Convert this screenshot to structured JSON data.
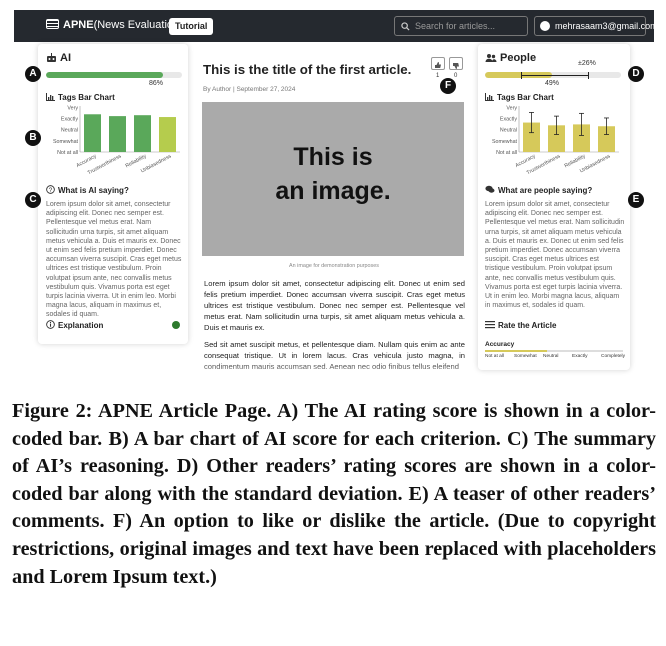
{
  "nav": {
    "brand": "APNE",
    "brand_sub": "(News Evaluation)",
    "tutorial": "Tutorial",
    "search_placeholder": "Search for articles...",
    "account": "mehrasaam3@gmail.com"
  },
  "ai": {
    "title": "AI",
    "score_label": "86%",
    "score": 0.86,
    "tags_title": "Tags Bar Chart",
    "summary_title": "What is AI saying?",
    "summary": "Lorem ipsum dolor sit amet, consectetur adipiscing elit. Donec nec semper est. Pellentesque vel metus erat. Nam sollicitudin urna turpis, sit amet aliquam metus vehicula a. Duis et mauris ex. Donec ut enim sed felis pretium imperdiet. Donec accumsan viverra suscipit. Cras eget metus ultrices est tristique vestibulum. Proin volutpat ipsum ante, nec convallis metus vestibulum quis. Vivamus porta est eget turpis lacinia viverra. Ut in enim leo. Morbi magna lacus, aliquam in maximus et, sodales id quam.",
    "explanation": "Explanation"
  },
  "article": {
    "title": "This is the title of the first article.",
    "byline": "By Author | September 27, 2024",
    "image_text_1": "This is",
    "image_text_2": "an image.",
    "image_caption": "An image for demonstration purposes",
    "para1": "Lorem ipsum dolor sit amet, consectetur adipiscing elit. Donec ut enim sed felis pretium imperdiet. Donec accumsan viverra suscipit. Cras eget metus ultrices est tristique vestibulum. Donec nec semper est. Pellentesque vel metus erat. Nam sollicitudin urna turpis, sit amet aliquam metus vehicula a. Duis et mauris ex.",
    "para2": "Sed sit amet suscipit metus, et pellentesque diam. Nullam quis enim ac ante consequat tristique. Ut in lorem lacus. Cras vehicula justo magna, in condimentum mauris accumsan sed. Aenean nec odio finibus tellus eleifend",
    "likes": "1",
    "dislikes": "0"
  },
  "people": {
    "title": "People",
    "std_label": "±26%",
    "score_label": "49%",
    "score": 0.49,
    "tags_title": "Tags Bar Chart",
    "comments_title": "What are people saying?",
    "comments": "Lorem ipsum dolor sit amet, consectetur adipiscing elit. Donec nec semper est. Pellentesque vel metus erat. Nam sollicitudin urna turpis, sit amet aliquam metus vehicula a. Duis et mauris ex. Donec ut enim sed felis pretium imperdiet. Donec accumsan viverra suscipit. Cras eget metus ultrices est tristique vestibulum. Proin volutpat ipsum ante, nec convallis metus vestibulum quis. Vivamus porta est eget turpis lacinia viverra. Ut in enim leo. Morbi magna lacus, aliquam in maximus et, sodales id quam.",
    "rate_title": "Rate the Article",
    "accuracy": "Accuracy",
    "scale": [
      "Not at all",
      "Somewhat",
      "Neutral",
      "Exactly",
      "Completely"
    ]
  },
  "markers": {
    "a": "A",
    "b": "B",
    "c": "C",
    "d": "D",
    "e": "E",
    "f": "F"
  },
  "caption": "Figure 2: APNE Article Page. A) The AI rating score is shown in a color-coded bar. B) A bar chart of AI score for each criterion. C) The summary of AI’s reasoning. D) Other readers’ rating scores are shown in a color-coded bar along with the standard deviation. E) A teaser of other readers’ comments. F) An option to like or dislike the article. (Due to copyright restrictions, original images and text have been replaced with placeholders and Lorem Ipsum text.)",
  "colors": {
    "ai_fill": "#5aa85a",
    "people_fill": "#d6c95a",
    "nav": "#25292f"
  },
  "chart_data": [
    {
      "type": "bar",
      "categories": [
        "Accuracy",
        "Trustworthiness",
        "Reliability",
        "Unbiasedness"
      ],
      "values": [
        4.1,
        3.9,
        4.0,
        3.8
      ],
      "yticks": [
        "Not at all",
        "Somewhat",
        "Neutral",
        "Exactly",
        "Very"
      ],
      "ylim": [
        0,
        5
      ],
      "colors": [
        "#5aa85a",
        "#5aa85a",
        "#5aa85a",
        "#b5cc4d"
      ]
    },
    {
      "type": "bar",
      "categories": [
        "Accuracy",
        "Trustworthiness",
        "Reliability",
        "Unbiasedness"
      ],
      "values": [
        3.2,
        2.9,
        3.0,
        2.8
      ],
      "errors": [
        1.1,
        1.0,
        1.2,
        0.9
      ],
      "yticks": [
        "Not at all",
        "Somewhat",
        "Neutral",
        "Exactly",
        "Very"
      ],
      "ylim": [
        0,
        5
      ],
      "colors": [
        "#d6c95a",
        "#d6c95a",
        "#d6c95a",
        "#d6c95a"
      ]
    }
  ]
}
